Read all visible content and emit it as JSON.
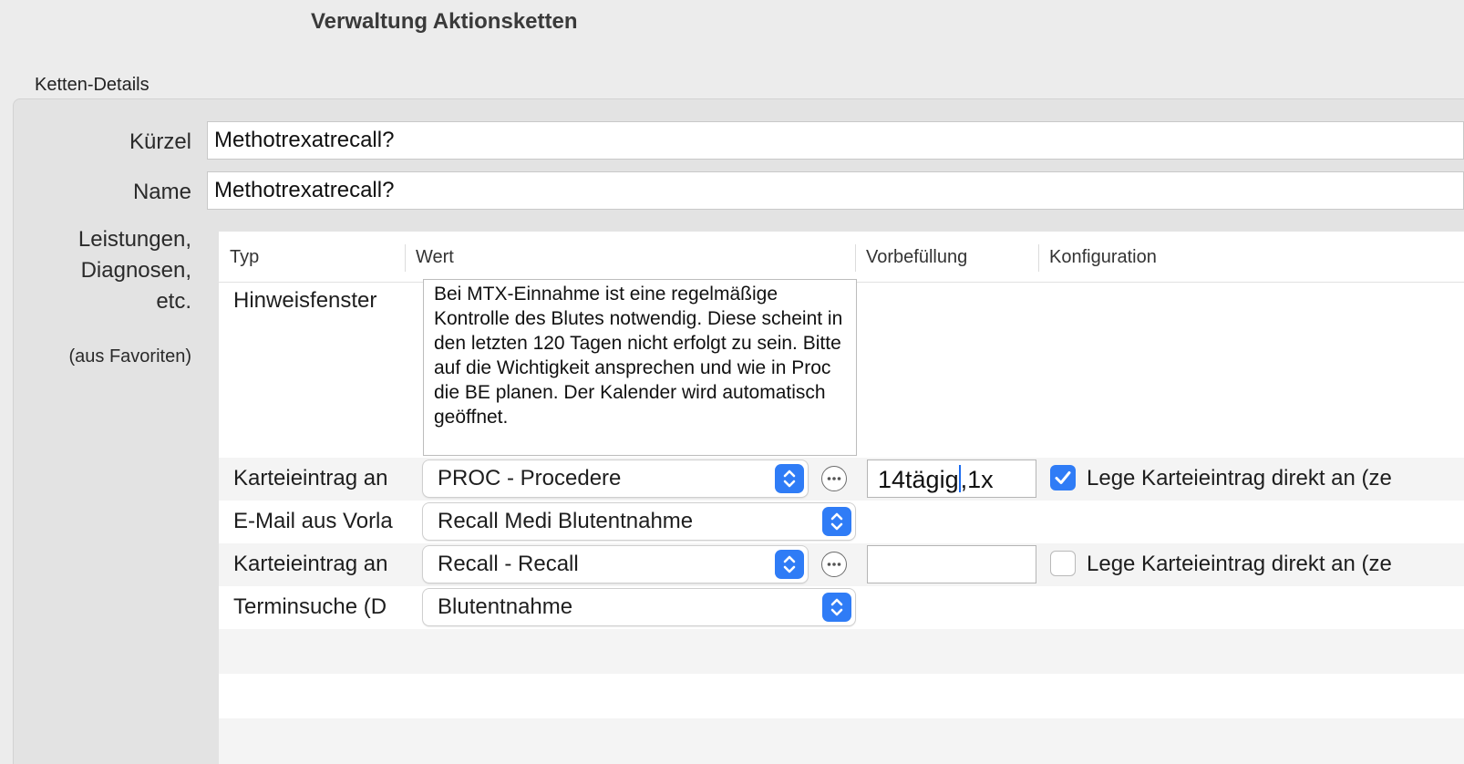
{
  "window": {
    "title": "Verwaltung Aktionsketten"
  },
  "group": {
    "label": "Ketten-Details"
  },
  "fields": {
    "kuerzel": {
      "label": "Kürzel",
      "value": "Methotrexatrecall?"
    },
    "name": {
      "label": "Name",
      "value": "Methotrexatrecall?"
    }
  },
  "services": {
    "label_line1": "Leistungen,",
    "label_line2": "Diagnosen,",
    "label_line3": "etc.",
    "hint": "(aus Favoriten)"
  },
  "table": {
    "columns": [
      "Typ",
      "Wert",
      "Vorbefüllung",
      "Konfiguration"
    ],
    "rows": [
      {
        "type": "Hinweisfenster",
        "text": "Bei MTX-Einnahme ist eine regelmäßige Kontrolle des Blutes notwendig. Diese scheint in den letzten 120 Tagen nicht erfolgt zu sein. Bitte auf die Wichtigkeit ansprechen und wie in Proc die BE planen. Der Kalender wird automatisch geöffnet."
      },
      {
        "type": "Karteieintrag an",
        "value": "PROC - Procedere",
        "prefill_before_cursor": "14tägig",
        "prefill_after_cursor": ",1x",
        "config": "Lege Karteieintrag direkt an (ze",
        "checked": true
      },
      {
        "type": "E-Mail aus Vorla",
        "value": "Recall Medi Blutentnahme"
      },
      {
        "type": "Karteieintrag an",
        "value": "Recall - Recall",
        "config": "Lege Karteieintrag direkt an (ze",
        "checked": false
      },
      {
        "type": "Terminsuche (D",
        "value": "Blutentnahme"
      }
    ]
  },
  "icons": {
    "stepper": "chevron-up-down-icon",
    "more": "ellipsis-circle-icon",
    "check": "checkmark-icon"
  },
  "colors": {
    "accent": "#2f7cf6",
    "window_bg": "#ececec",
    "group_bg": "#e3e3e3",
    "alt_row": "#f4f4f4"
  }
}
